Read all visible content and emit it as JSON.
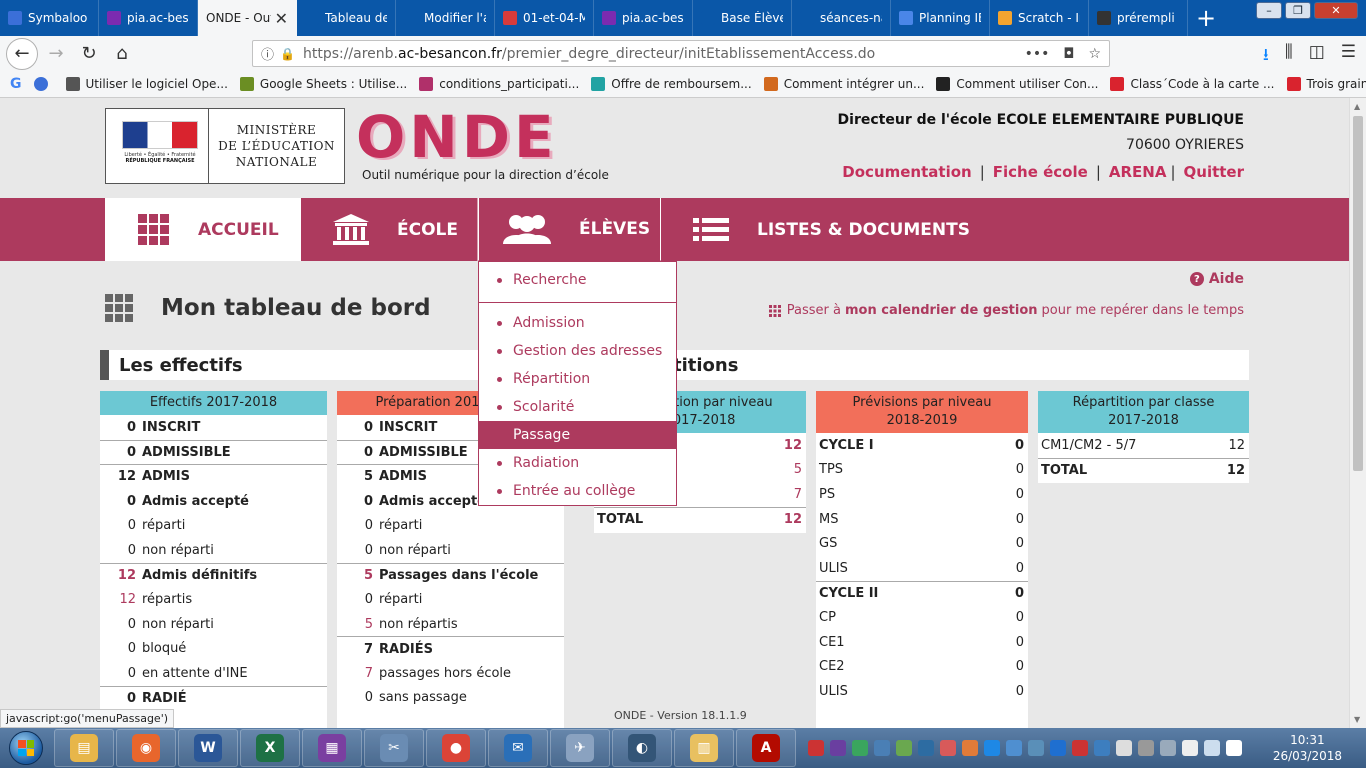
{
  "browser": {
    "tabs": [
      {
        "label": "Symbaloo",
        "color": "#3b6fd8",
        "active": false
      },
      {
        "label": "pia.ac-besa",
        "color": "#7b2bb0",
        "active": false
      },
      {
        "label": "ONDE - Outi",
        "color": "#ffffff",
        "active": true
      },
      {
        "label": "Tableau de bor",
        "color": "#0a57a8",
        "active": false
      },
      {
        "label": "Modifier l'artic",
        "color": "#0a57a8",
        "active": false
      },
      {
        "label": "01-et-04-M",
        "color": "#d73b3b",
        "active": false
      },
      {
        "label": "pia.ac-besa",
        "color": "#7b2bb0",
        "active": false
      },
      {
        "label": "Base Élève - 1e",
        "color": "#0a57a8",
        "active": false
      },
      {
        "label": "séances-nageu",
        "color": "#0a57a8",
        "active": false
      },
      {
        "label": "Planning IE",
        "color": "#4a86e8",
        "active": false
      },
      {
        "label": "Scratch - Ir",
        "color": "#f3a430",
        "active": false
      },
      {
        "label": "prérempli",
        "color": "#333333",
        "active": false
      }
    ],
    "url_prefix": "https://arenb.",
    "url_domain": "ac-besancon.fr",
    "url_path": "/premier_degre_directeur/initEtablissementAccess.do",
    "bookmarks": [
      {
        "label": "Utiliser le logiciel Ope...",
        "color": "#555555"
      },
      {
        "label": "Google Sheets : Utilise...",
        "color": "#6b8e23"
      },
      {
        "label": "conditions_participati...",
        "color": "#b0306a"
      },
      {
        "label": "Offre de remboursem...",
        "color": "#21a3a3"
      },
      {
        "label": "Comment intégrer un...",
        "color": "#d2691e"
      },
      {
        "label": "Comment utiliser Con...",
        "color": "#222222"
      },
      {
        "label": "Class´Code à la carte ...",
        "color": "#d9232e"
      },
      {
        "label": "Trois grains vidéos po...",
        "color": "#d9232e"
      }
    ]
  },
  "header": {
    "ministry_line1": "MINISTÈRE",
    "ministry_line2": "DE L’ÉDUCATION",
    "ministry_line3": "NATIONALE",
    "motto": "Liberté • Égalité • Fraternité",
    "republic": "RÉPUBLIQUE FRANÇAISE",
    "app_name": "ONDE",
    "app_subtitle": "Outil numérique pour la direction d’école",
    "director_title": "Directeur de l'école ECOLE ELEMENTAIRE PUBLIQUE",
    "city": "70600 OYRIERES",
    "links": {
      "documentation": "Documentation",
      "fiche": "Fiche école",
      "arena": "ARENA",
      "quitter": "Quitter"
    }
  },
  "menu": {
    "accueil": "ACCUEIL",
    "ecole": "ÉCOLE",
    "eleves": "ÉLÈVES",
    "listes": "LISTES & DOCUMENTS"
  },
  "dropdown": {
    "first": "Recherche",
    "items": [
      "Admission",
      "Gestion des adresses",
      "Répartition",
      "Scolarité",
      "Passage",
      "Radiation",
      "Entrée au collège"
    ],
    "hovered": "Passage"
  },
  "dashboard": {
    "aide": "Aide",
    "title": "Mon tableau de bord",
    "cal_prefix": "Passer à",
    "cal_link": "mon calendrier de gestion",
    "cal_suffix": "pour me repérer dans le temps",
    "section_effectifs": "Les effectifs",
    "section_repartitions": "Répartitions"
  },
  "effectifs": {
    "header": "Effectifs 2017-2018",
    "rows": [
      {
        "n": "0",
        "label": "INSCRIT",
        "bold": true,
        "line": false
      },
      {
        "n": "0",
        "label": "ADMISSIBLE",
        "bold": true,
        "line": true
      },
      {
        "n": "12",
        "label": "ADMIS",
        "bold": true,
        "line": true
      },
      {
        "n": "0",
        "label": "Admis accepté",
        "bold": true,
        "line": false
      },
      {
        "n": "0",
        "label": "réparti",
        "bold": false,
        "line": false
      },
      {
        "n": "0",
        "label": "non réparti",
        "bold": false,
        "line": false
      },
      {
        "n": "12",
        "label": "Admis définitifs",
        "bold": true,
        "line": true,
        "pink": true
      },
      {
        "n": "12",
        "label": "répartis",
        "bold": false,
        "line": false,
        "pink": true
      },
      {
        "n": "0",
        "label": "non réparti",
        "bold": false,
        "line": false
      },
      {
        "n": "0",
        "label": "bloqué",
        "bold": false,
        "line": false
      },
      {
        "n": "0",
        "label": "en attente d'INE",
        "bold": false,
        "line": false
      },
      {
        "n": "0",
        "label": "RADIÉ",
        "bold": true,
        "line": true
      }
    ]
  },
  "preparation": {
    "header": "Préparation 2018-2019",
    "rows": [
      {
        "n": "0",
        "label": "INSCRIT",
        "bold": true,
        "line": false
      },
      {
        "n": "0",
        "label": "ADMISSIBLE",
        "bold": true,
        "line": true
      },
      {
        "n": "5",
        "label": "ADMIS",
        "bold": true,
        "line": true
      },
      {
        "n": "0",
        "label": "Admis accepté",
        "bold": true,
        "line": false
      },
      {
        "n": "0",
        "label": "réparti",
        "bold": false,
        "line": false
      },
      {
        "n": "0",
        "label": "non réparti",
        "bold": false,
        "line": false
      },
      {
        "n": "5",
        "label": "Passages dans l'école",
        "bold": true,
        "line": true,
        "pink": true
      },
      {
        "n": "0",
        "label": "réparti",
        "bold": false,
        "line": false
      },
      {
        "n": "5",
        "label": "non répartis",
        "bold": false,
        "line": false,
        "pink": true
      },
      {
        "n": "7",
        "label": "RADIÉS",
        "bold": true,
        "line": true
      },
      {
        "n": "7",
        "label": "passages hors école",
        "bold": false,
        "line": false,
        "pink": true
      },
      {
        "n": "0",
        "label": "sans passage",
        "bold": false,
        "line": false
      }
    ]
  },
  "repartition_niveau": {
    "header_line1": "Répartition par niveau",
    "header_line2": "2017-2018",
    "rows": [
      {
        "label": "",
        "value": "12",
        "bold": true,
        "pink": true,
        "line": false
      },
      {
        "label": "",
        "value": "5",
        "bold": false,
        "pink": true,
        "line": false
      },
      {
        "label": "",
        "value": "7",
        "bold": false,
        "pink": true,
        "line": false
      },
      {
        "label": "TOTAL",
        "value": "12",
        "bold": true,
        "pink": true,
        "line": true
      }
    ]
  },
  "previsions": {
    "header_line1": "Prévisions par niveau",
    "header_line2": "2018-2019",
    "rows": [
      {
        "label": "CYCLE I",
        "value": "0",
        "bold": true,
        "line": false
      },
      {
        "label": "TPS",
        "value": "0",
        "bold": false,
        "line": false
      },
      {
        "label": "PS",
        "value": "0",
        "bold": false,
        "line": false
      },
      {
        "label": "MS",
        "value": "0",
        "bold": false,
        "line": false
      },
      {
        "label": "GS",
        "value": "0",
        "bold": false,
        "line": false
      },
      {
        "label": "ULIS",
        "value": "0",
        "bold": false,
        "line": false
      },
      {
        "label": "CYCLE II",
        "value": "0",
        "bold": true,
        "line": true
      },
      {
        "label": "CP",
        "value": "0",
        "bold": false,
        "line": false
      },
      {
        "label": "CE1",
        "value": "0",
        "bold": false,
        "line": false
      },
      {
        "label": "CE2",
        "value": "0",
        "bold": false,
        "line": false
      },
      {
        "label": "ULIS",
        "value": "0",
        "bold": false,
        "line": false
      }
    ]
  },
  "repartition_classe": {
    "header_line1": "Répartition par classe",
    "header_line2": "2017-2018",
    "rows": [
      {
        "label": "CM1/CM2 - 5/7",
        "value": "12",
        "bold": false,
        "line": false
      },
      {
        "label": "TOTAL",
        "value": "12",
        "bold": true,
        "line": true
      }
    ]
  },
  "footer": {
    "version": "ONDE - Version 18.1.1.9",
    "status": "javascript:go('menuPassage')"
  },
  "taskbar": {
    "apps": [
      {
        "name": "explorer",
        "color": "#e7b64a",
        "glyph": "▤"
      },
      {
        "name": "firefox",
        "color": "#e8662c",
        "glyph": "◉"
      },
      {
        "name": "word",
        "color": "#2b5797",
        "glyph": "W"
      },
      {
        "name": "excel",
        "color": "#1e7145",
        "glyph": "X"
      },
      {
        "name": "photo",
        "color": "#7a3fa0",
        "glyph": "▦"
      },
      {
        "name": "tool",
        "color": "#6a8cb3",
        "glyph": "✂"
      },
      {
        "name": "chrome",
        "color": "#db4437",
        "glyph": "●"
      },
      {
        "name": "thunderbird",
        "color": "#2a6fb8",
        "glyph": "✉"
      },
      {
        "name": "mail",
        "color": "#8aa2c0",
        "glyph": "✈"
      },
      {
        "name": "vpn",
        "color": "#335577",
        "glyph": "◐"
      },
      {
        "name": "folder",
        "color": "#e8c060",
        "glyph": "▥"
      },
      {
        "name": "acrobat",
        "color": "#b30b00",
        "glyph": "A"
      }
    ],
    "time": "10:31",
    "date": "26/03/2018"
  }
}
